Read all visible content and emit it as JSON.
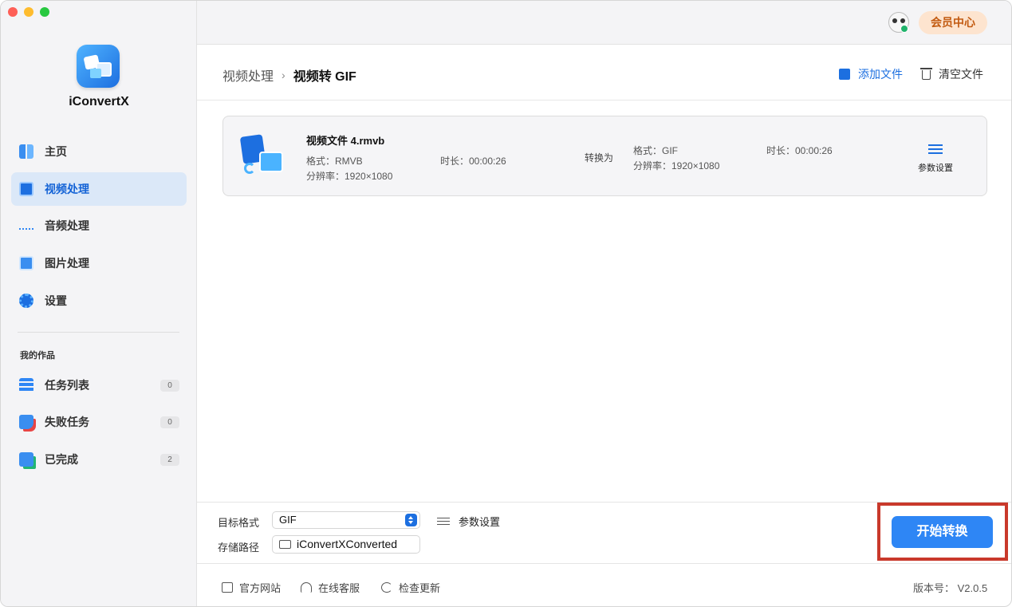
{
  "app": {
    "name": "iConvertX"
  },
  "topbar": {
    "vip_label": "会员中心"
  },
  "sidebar": {
    "items": [
      {
        "label": "主页"
      },
      {
        "label": "视频处理"
      },
      {
        "label": "音频处理"
      },
      {
        "label": "图片处理"
      },
      {
        "label": "设置"
      }
    ],
    "section_title": "我的作品",
    "works": [
      {
        "label": "任务列表",
        "count": "0"
      },
      {
        "label": "失败任务",
        "count": "0"
      },
      {
        "label": "已完成",
        "count": "2"
      }
    ]
  },
  "header": {
    "crumb_parent": "视频处理",
    "crumb_sep": "›",
    "crumb_current": "视频转 GIF",
    "add_label": "添加文件",
    "clear_label": "清空文件"
  },
  "file": {
    "name": "视频文件 4.rmvb",
    "src_format": "格式：RMVB",
    "src_resolution": "分辨率：1920×1080",
    "src_duration": "时长：00:00:26",
    "convert_to": "转换为",
    "dst_format": "格式：GIF",
    "dst_resolution": "分辨率：1920×1080",
    "dst_duration": "时长：00:00:26",
    "params_label": "参数设置"
  },
  "bottom": {
    "target_label": "目标格式",
    "target_value": "GIF",
    "params_label": "参数设置",
    "path_label": "存储路径",
    "path_value": "iConvertXConverted",
    "start_label": "开始转换"
  },
  "footer": {
    "website": "官方网站",
    "support": "在线客服",
    "update": "检查更新",
    "version": "版本号： V2.0.5"
  },
  "colors": {
    "accent": "#2e86f5",
    "highlight": "#c9392b"
  }
}
